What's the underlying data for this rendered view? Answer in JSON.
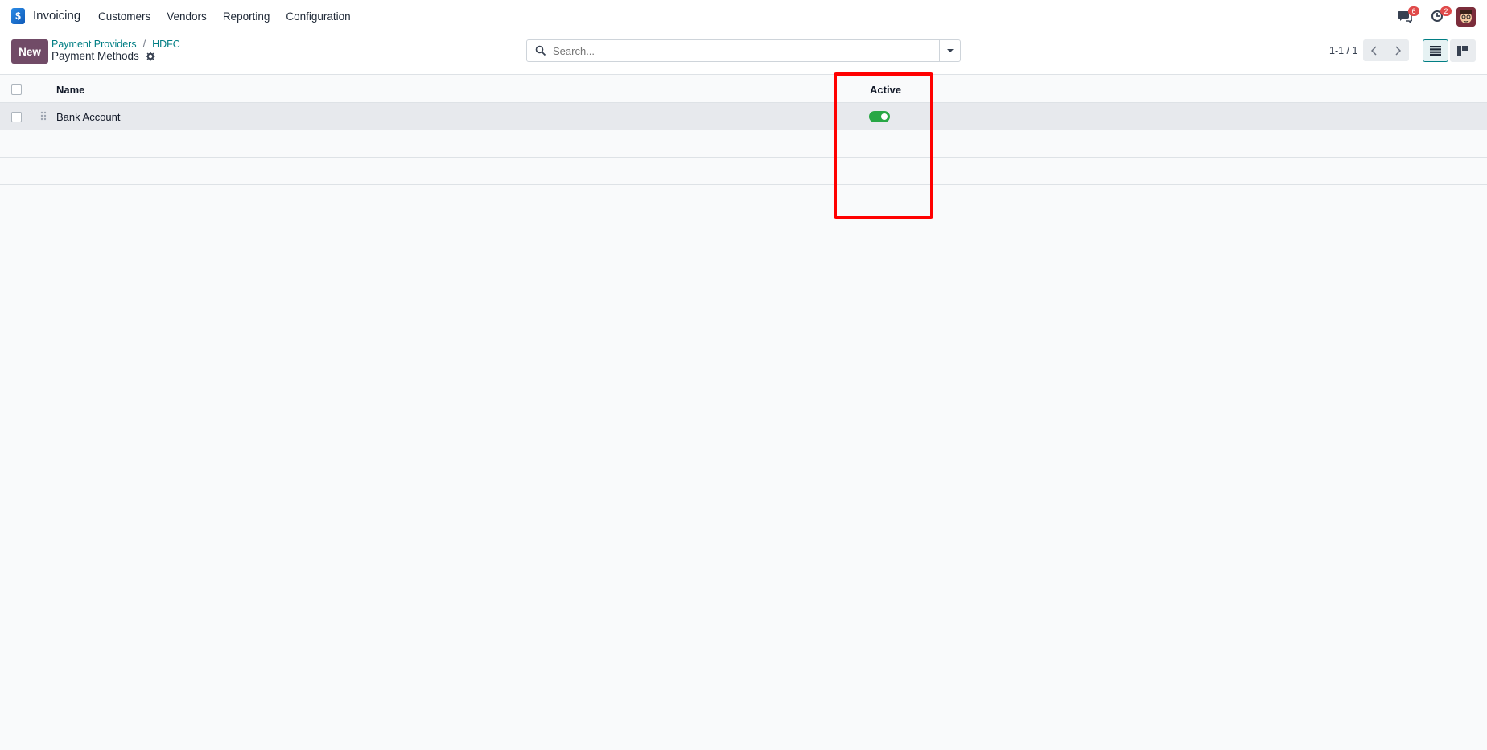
{
  "navbar": {
    "app_name": "Invoicing",
    "menu": [
      "Customers",
      "Vendors",
      "Reporting",
      "Configuration"
    ],
    "messages_badge": "6",
    "activities_badge": "2"
  },
  "control_panel": {
    "new_label": "New",
    "breadcrumb": [
      "Payment Providers",
      "HDFC"
    ],
    "title": "Payment Methods",
    "search_placeholder": "Search...",
    "pager": "1-1 / 1"
  },
  "table": {
    "headers": {
      "name": "Name",
      "active": "Active"
    },
    "rows": [
      {
        "name": "Bank Account",
        "active": true
      }
    ]
  },
  "colors": {
    "brand": "#714b67",
    "link": "#017e84",
    "toggle_on": "#28a745",
    "highlight": "#ff0000"
  }
}
